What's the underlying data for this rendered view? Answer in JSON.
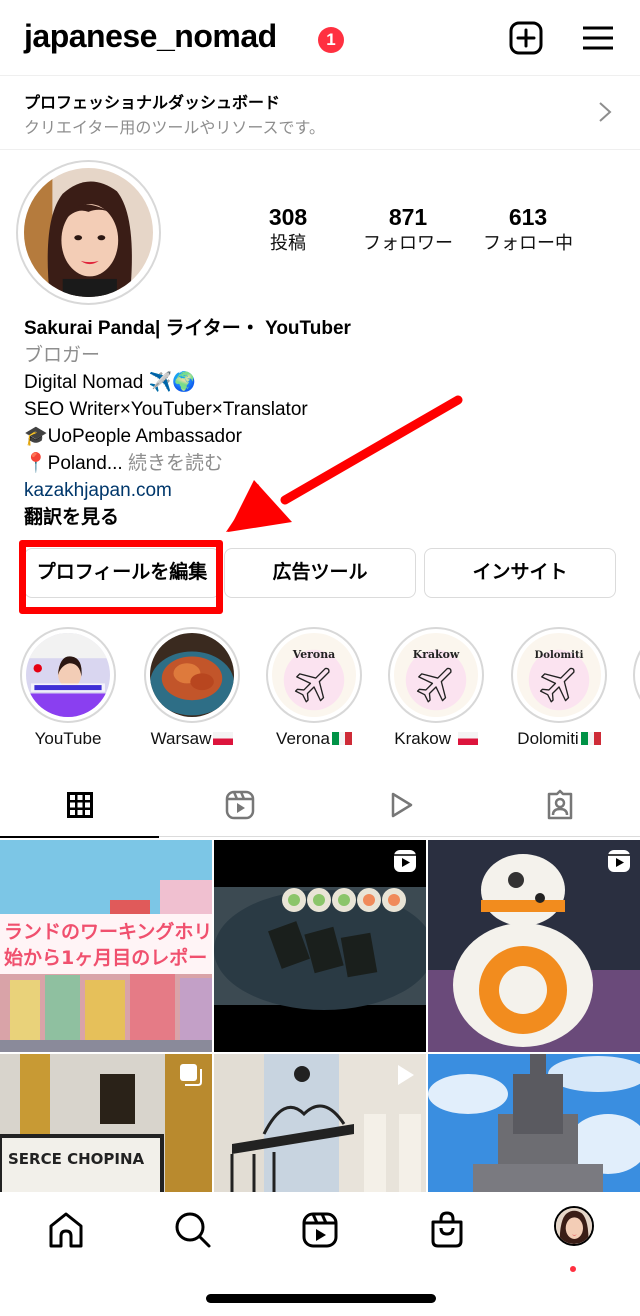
{
  "header": {
    "username": "japanese_nomad",
    "notification_count": "1",
    "icons": [
      "add-post-icon",
      "menu-icon"
    ]
  },
  "dashboard": {
    "title": "プロフェッショナルダッシュボード",
    "subtitle": "クリエイター用のツールやリソースです。"
  },
  "profile": {
    "stats": [
      {
        "value": "308",
        "label": "投稿"
      },
      {
        "value": "871",
        "label": "フォロワー"
      },
      {
        "value": "613",
        "label": "フォロー中"
      }
    ],
    "name": "Sakurai Panda| ライター・ YouTuber",
    "category": "ブロガー",
    "bio_lines": [
      "Digital Nomad ✈️🌍",
      "SEO Writer×YouTuber×Translator",
      "🎓UoPeople Ambassador",
      "📍Poland..."
    ],
    "read_more": "続きを読む",
    "website": "kazakhjapan.com",
    "translate": "翻訳を見る"
  },
  "buttons": {
    "edit_profile": "プロフィールを編集",
    "ad_tools": "広告ツール",
    "insights": "インサイト"
  },
  "annotation": {
    "color": "#ff0000",
    "target": "edit_profile"
  },
  "highlights": [
    {
      "label": "YouTube",
      "flag": ""
    },
    {
      "label": "Warsaw",
      "flag": "poland"
    },
    {
      "label": "Verona",
      "flag": "italy"
    },
    {
      "label": "Krakow ",
      "flag": "poland"
    },
    {
      "label": "Dolomiti",
      "flag": "italy"
    }
  ],
  "highlight_cover_titles": {
    "verona": "Verona",
    "krakow": "Krakow",
    "dolomiti": "Dolomiti"
  },
  "tabs": [
    "grid-tab",
    "reels-tab",
    "videos-tab",
    "tagged-tab"
  ],
  "active_tab": "grid-tab",
  "grid_posts": [
    {
      "description": "Wrocław market square with pink banner",
      "overlay_text_1": "ランドのワーキングホリ",
      "overlay_text_2": "始から1ヶ月目のレポー",
      "badge": ""
    },
    {
      "description": "Sushi rolls on plate",
      "badge": "reel"
    },
    {
      "description": "LEGO BB-8 droid",
      "badge": "reel"
    },
    {
      "description": "Church interior with sign",
      "sign_text": "SERCE CHOPINA",
      "badge": "carousel"
    },
    {
      "description": "Ornate iron gate",
      "badge": "video"
    },
    {
      "description": "Palace of Culture and Science",
      "badge": ""
    }
  ],
  "bottom_nav": [
    "home",
    "search",
    "reels",
    "shop",
    "profile"
  ],
  "colors": {
    "badge_red": "#ff3040",
    "link_blue": "#00376b",
    "secondary_text": "#8e8e8e",
    "border": "#dbdbdb"
  }
}
